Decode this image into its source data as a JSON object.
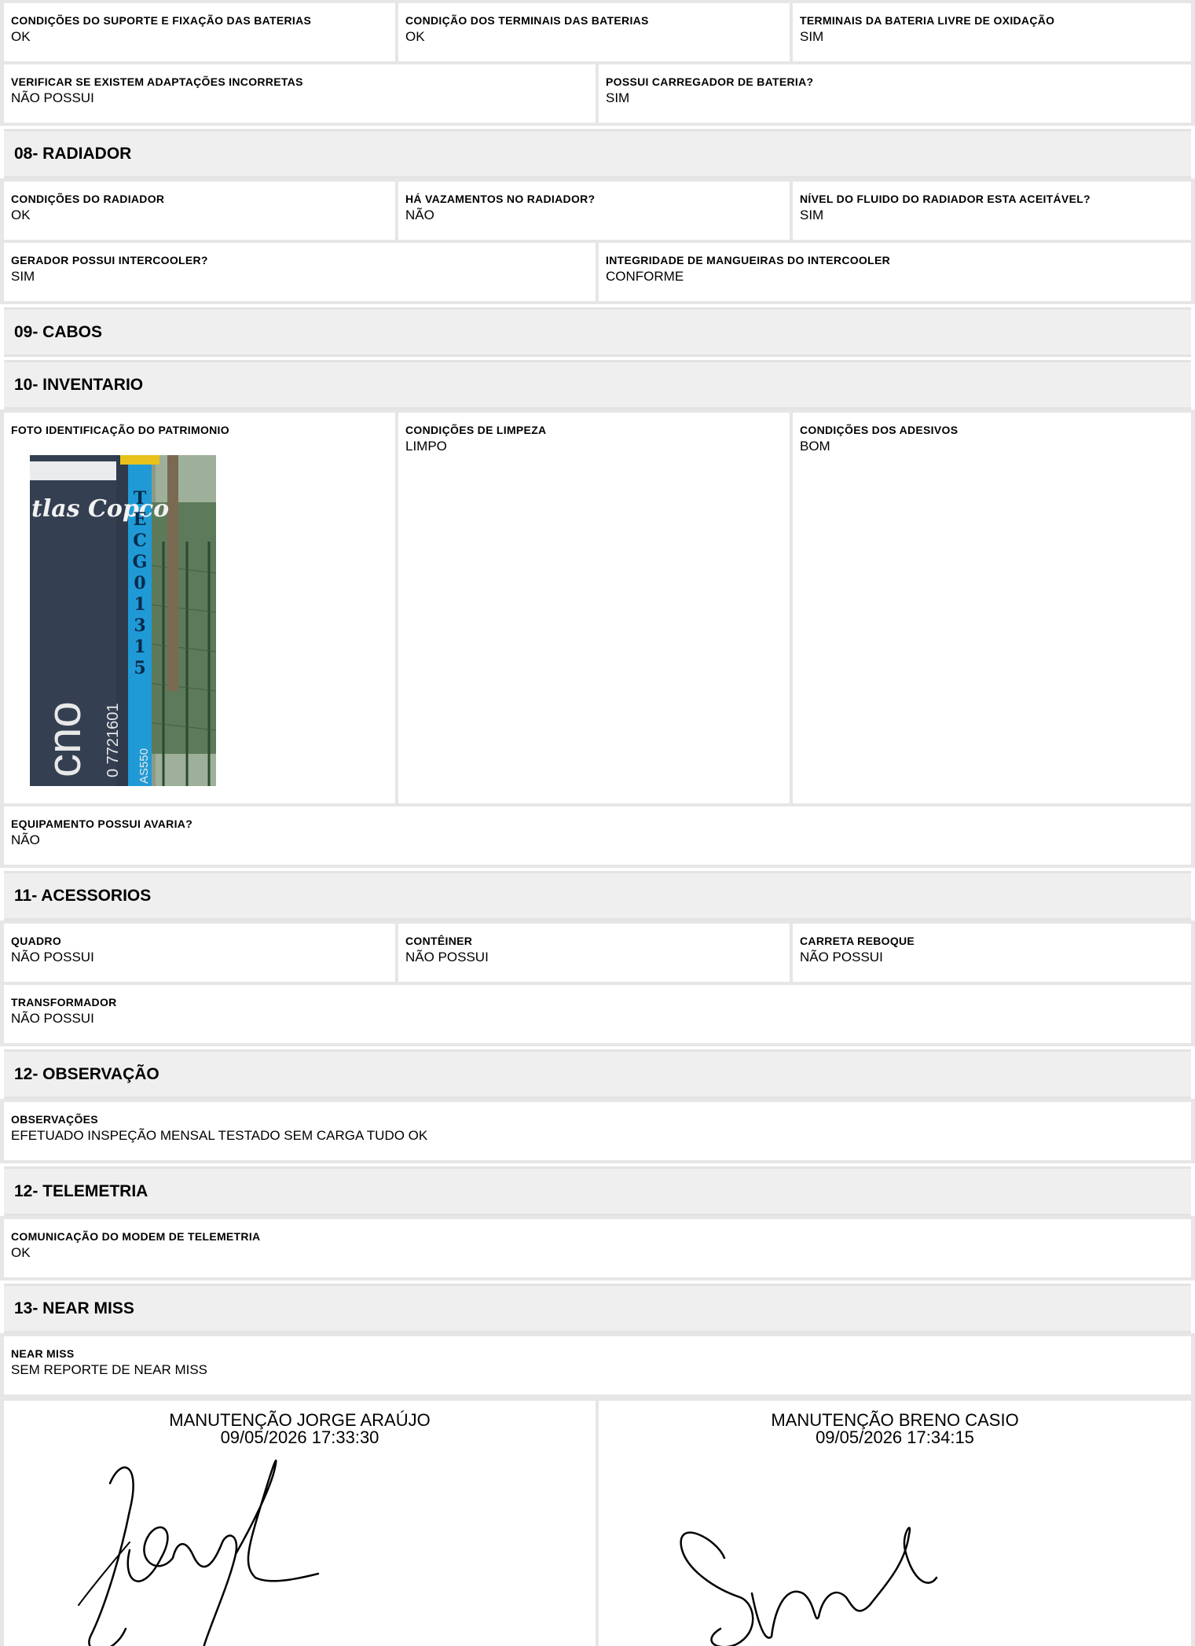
{
  "battery": {
    "suporte": {
      "label": "CONDIÇÕES DO SUPORTE E FIXAÇÃO DAS BATERIAS",
      "value": "OK"
    },
    "terminais": {
      "label": "CONDIÇÃO DOS TERMINAIS DAS BATERIAS",
      "value": "OK"
    },
    "oxidacao": {
      "label": "TERMINAIS DA BATERIA LIVRE DE OXIDAÇÃO",
      "value": "SIM"
    },
    "adaptacoes": {
      "label": "VERIFICAR SE EXISTEM ADAPTAÇÕES INCORRETAS",
      "value": "NÃO POSSUI"
    },
    "carregador": {
      "label": "POSSUI CARREGADOR DE BATERIA?",
      "value": "SIM"
    }
  },
  "radiador": {
    "title": "08- RADIADOR",
    "condicoes": {
      "label": "CONDIÇÕES DO RADIADOR",
      "value": "OK"
    },
    "vazamentos": {
      "label": "HÁ VAZAMENTOS NO RADIADOR?",
      "value": "NÃO"
    },
    "fluido": {
      "label": "NÍVEL DO FLUIDO DO RADIADOR ESTA ACEITÁVEL?",
      "value": "SIM"
    },
    "intercooler": {
      "label": "GERADOR POSSUI INTERCOOLER?",
      "value": "SIM"
    },
    "mangueiras": {
      "label": "INTEGRIDADE DE MANGUEIRAS DO INTERCOOLER",
      "value": "CONFORME"
    }
  },
  "cabos": {
    "title": "09- CABOS"
  },
  "inventario": {
    "title": "10- INVENTARIO",
    "foto": {
      "label": "FOTO IDENTIFICAÇÃO DO PATRIMONIO",
      "brand": "tlas Copco",
      "code": "TECG01315",
      "phone": "0 7721601",
      "model": "AS550",
      "large": "cno"
    },
    "limpeza": {
      "label": "CONDIÇÕES DE LIMPEZA",
      "value": "LIMPO"
    },
    "adesivos": {
      "label": "CONDIÇÕES DOS ADESIVOS",
      "value": "BOM"
    },
    "avaria": {
      "label": "EQUIPAMENTO POSSUI AVARIA?",
      "value": "NÃO"
    }
  },
  "acessorios": {
    "title": "11- ACESSORIOS",
    "quadro": {
      "label": "QUADRO",
      "value": "NÃO POSSUI"
    },
    "conteiner": {
      "label": "CONTÊINER",
      "value": "NÃO POSSUI"
    },
    "carreta": {
      "label": "CARRETA REBOQUE",
      "value": "NÃO POSSUI"
    },
    "transformador": {
      "label": "TRANSFORMADOR",
      "value": "NÃO POSSUI"
    }
  },
  "observacao": {
    "title": "12- OBSERVAÇÃO",
    "obs": {
      "label": "OBSERVAÇÕES",
      "value": "EFETUADO INSPEÇÃO MENSAL TESTADO SEM CARGA TUDO OK"
    }
  },
  "telemetria": {
    "title": "12- TELEMETRIA",
    "modem": {
      "label": "COMUNICAÇÃO DO MODEM DE TELEMETRIA",
      "value": "OK"
    }
  },
  "nearmiss": {
    "title": "13- NEAR MISS",
    "nm": {
      "label": "NEAR MISS",
      "value": "SEM REPORTE DE NEAR MISS"
    }
  },
  "signatures": [
    {
      "name": "MANUTENÇÃO JORGE ARAÚJO",
      "datetime": "09/05/2026 17:33:30"
    },
    {
      "name": "MANUTENÇÃO BRENO CASIO",
      "datetime": "09/05/2026 17:34:15"
    }
  ]
}
